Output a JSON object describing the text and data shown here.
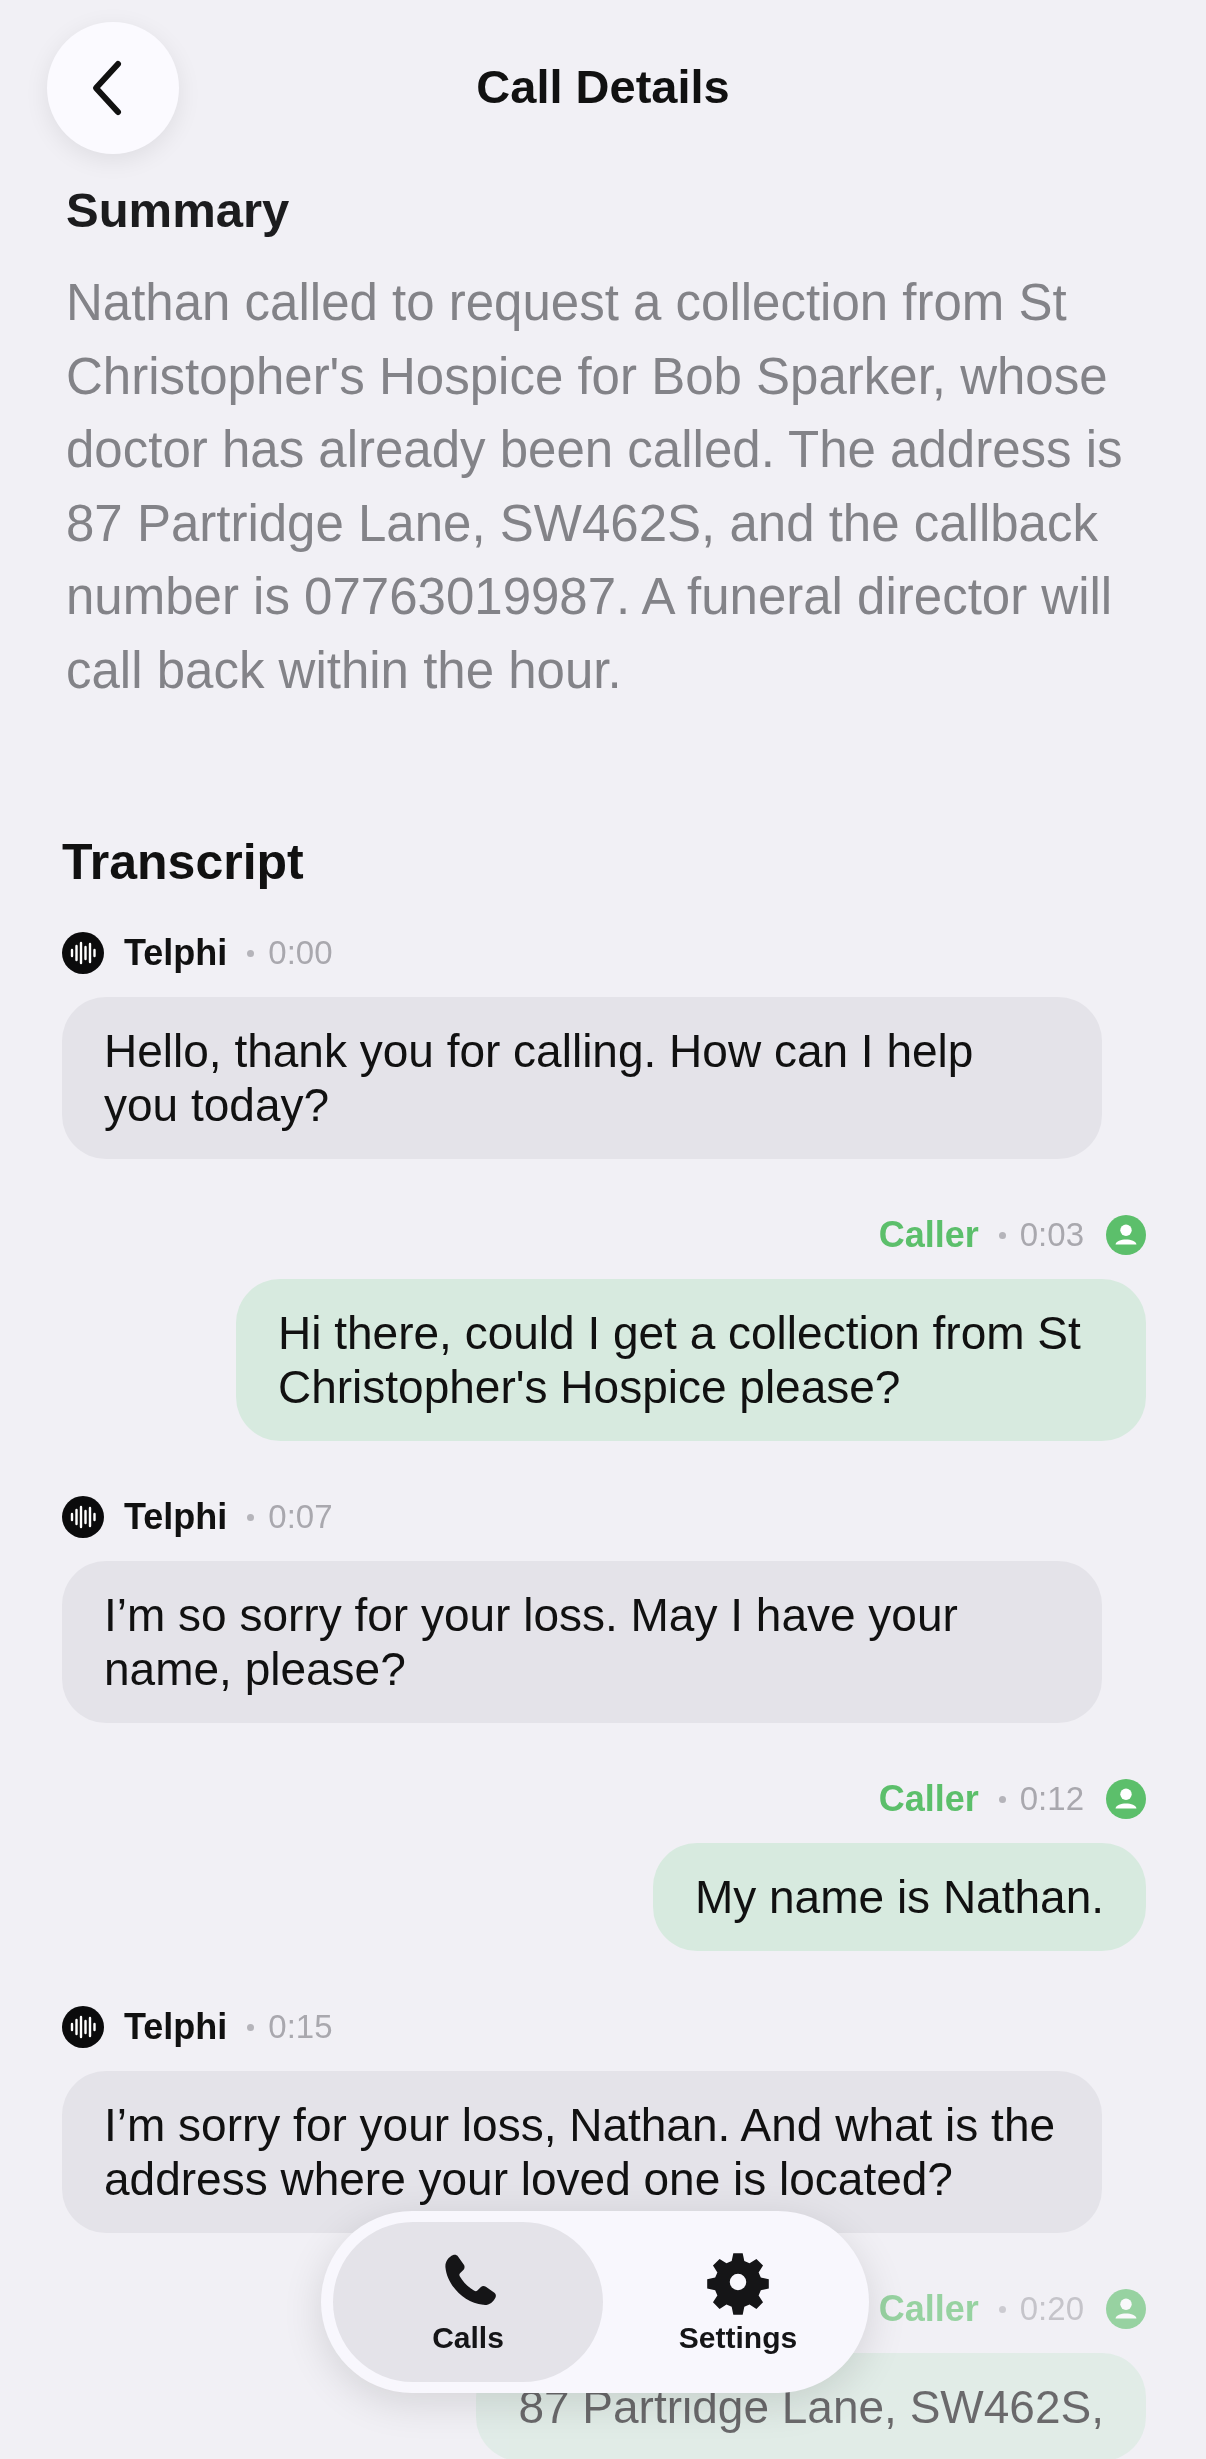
{
  "header": {
    "title": "Call Details"
  },
  "summary": {
    "heading": "Summary",
    "text": "Nathan called to request a collection from St Christopher's Hospice for Bob Sparker, whose doctor has already been called. The address is 87 Partridge Lane, SW462S, and the callback number is 07763019987. A funeral director will call back within the hour."
  },
  "transcript": {
    "heading": "Transcript",
    "messages": [
      {
        "kind": "agent",
        "speaker": "Telphi",
        "time": "0:00",
        "text": "Hello, thank you for calling. How can I help you today?"
      },
      {
        "kind": "caller",
        "speaker": "Caller",
        "time": "0:03",
        "text": "Hi there, could I get a collection from St Christopher's Hospice please?"
      },
      {
        "kind": "agent",
        "speaker": "Telphi",
        "time": "0:07",
        "text": "I’m so sorry for your loss. May I have your name, please?"
      },
      {
        "kind": "caller",
        "speaker": "Caller",
        "time": "0:12",
        "text": "My name is Nathan."
      },
      {
        "kind": "agent",
        "speaker": "Telphi",
        "time": "0:15",
        "text": "I’m sorry for your loss, Nathan. And what is the address where your loved one is located?"
      },
      {
        "kind": "caller",
        "speaker": "Caller",
        "time": "0:20",
        "text": "87 Partridge Lane, SW462S,"
      }
    ]
  },
  "tab_bar": {
    "tabs": [
      {
        "kind": "calls",
        "label": "Calls",
        "selected": true
      },
      {
        "kind": "settings",
        "label": "Settings",
        "selected": false
      }
    ]
  }
}
